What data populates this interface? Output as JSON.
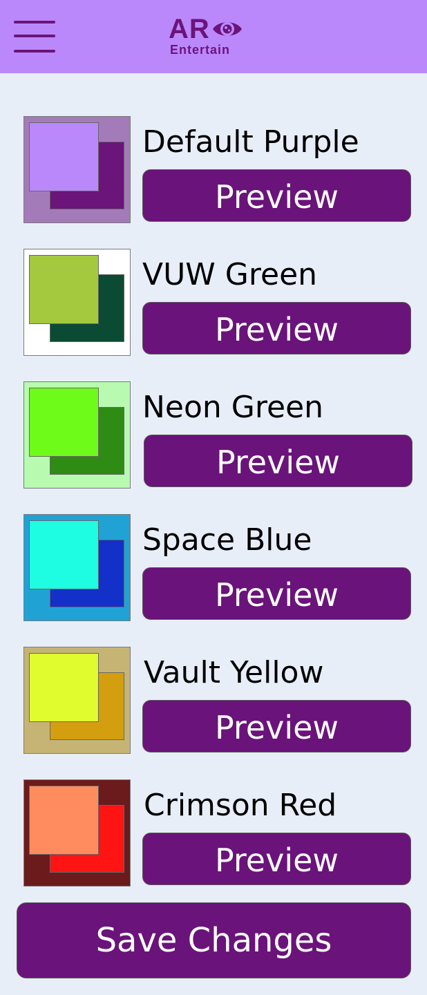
{
  "header": {
    "logo_letters": "AR",
    "logo_sub": "Entertain",
    "accent": "#bb88fc",
    "brand": "#6b1479"
  },
  "themes": [
    {
      "name": "Default Purple",
      "preview_label": "Preview",
      "bg": "#a27bb8",
      "back": "#6b1479",
      "front": "#bb88fc"
    },
    {
      "name": "VUW Green",
      "preview_label": "Preview",
      "bg": "#ffffff",
      "back": "#0b4b33",
      "front": "#a4c93e"
    },
    {
      "name": "Neon Green",
      "preview_label": "Preview",
      "bg": "#b7fab0",
      "back": "#2e8c14",
      "front": "#6ffb19"
    },
    {
      "name": "Space Blue",
      "preview_label": "Preview",
      "bg": "#21a2d5",
      "back": "#1330c8",
      "front": "#1efde1"
    },
    {
      "name": "Vault Yellow",
      "preview_label": "Preview",
      "bg": "#c6b474",
      "back": "#d49f0f",
      "front": "#e0fb2e"
    },
    {
      "name": "Crimson Red",
      "preview_label": "Preview",
      "bg": "#6b1b1b",
      "back": "#ff1414",
      "front": "#ff8c5e"
    }
  ],
  "save_label": "Save Changes"
}
